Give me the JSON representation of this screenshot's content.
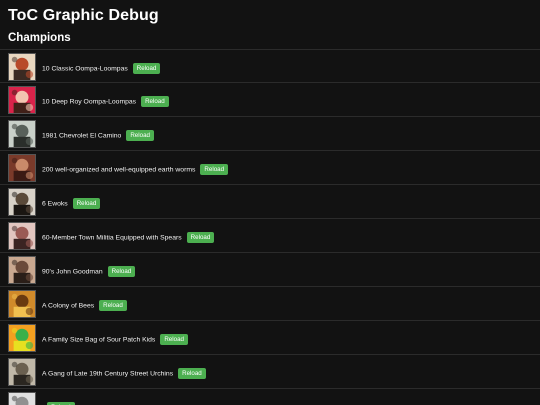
{
  "page": {
    "title": "ToC Graphic Debug",
    "section": "Champions"
  },
  "reload_label": "Reload",
  "items": [
    {
      "label": "10 Classic Oompa-Loompas",
      "thumb_icon": "portrait-thumbnail",
      "colors": [
        "#e9d7c0",
        "#b84a2a",
        "#3b2a22"
      ]
    },
    {
      "label": "10 Deep Roy Oompa-Loompas",
      "thumb_icon": "portrait-thumbnail",
      "colors": [
        "#d9234a",
        "#f2c4b0",
        "#402018"
      ]
    },
    {
      "label": "1981 Chevrolet El Camino",
      "thumb_icon": "car-thumbnail",
      "colors": [
        "#c9d0c9",
        "#58605a",
        "#2a2e2a"
      ]
    },
    {
      "label": "200 well-organized and well-equipped earth worms",
      "thumb_icon": "worms-thumbnail",
      "colors": [
        "#7a3a2a",
        "#c98a6a",
        "#3a1a14"
      ]
    },
    {
      "label": "6 Ewoks",
      "thumb_icon": "ewoks-thumbnail",
      "colors": [
        "#d8d2c8",
        "#5a4a3a",
        "#1a1612"
      ]
    },
    {
      "label": "60-Member Town Militia Equipped with Spears",
      "thumb_icon": "militia-thumbnail",
      "colors": [
        "#e2c6c0",
        "#9a5a54",
        "#3a2422"
      ]
    },
    {
      "label": "90's John Goodman",
      "thumb_icon": "portrait-thumbnail",
      "colors": [
        "#c9a890",
        "#6a4a3a",
        "#2a1e18"
      ]
    },
    {
      "label": "A Colony of Bees",
      "thumb_icon": "bees-thumbnail",
      "colors": [
        "#d08a2a",
        "#6a3a10",
        "#f0c050"
      ]
    },
    {
      "label": "A Family Size Bag of Sour Patch Kids",
      "thumb_icon": "candy-thumbnail",
      "colors": [
        "#f4a020",
        "#3ab04a",
        "#e8e020"
      ]
    },
    {
      "label": "A Gang of Late 19th Century Street Urchins",
      "thumb_icon": "urchins-thumbnail",
      "colors": [
        "#c0b8a8",
        "#6a6050",
        "#2a2620"
      ]
    },
    {
      "label": "",
      "thumb_icon": "partial-thumbnail",
      "colors": [
        "#e0e0e0",
        "#909090",
        "#404040"
      ]
    }
  ]
}
